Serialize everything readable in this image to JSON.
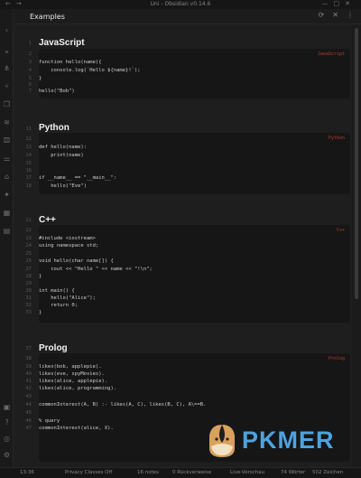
{
  "window": {
    "title": "Uni - Obsidian v0.14.6",
    "nav_back": "←",
    "nav_forward": "→",
    "controls": [
      "—",
      "□",
      "✕"
    ]
  },
  "ribbon": {
    "icons": [
      "chevron-right-icon",
      "map-pin-icon",
      "graph-icon",
      "git-branch-icon",
      "copy-icon",
      "layers-icon",
      "dice-icon",
      "sliders-icon",
      "bookmark-icon",
      "settings-icon",
      "calendar-icon",
      "grid-icon",
      "terminal-icon",
      "help-icon",
      "vault-icon",
      "gear-icon"
    ]
  },
  "tab": {
    "label": "Examples",
    "actions": [
      "⟳",
      "✕",
      "⋮"
    ]
  },
  "sections": [
    {
      "heading": "JavaScript",
      "heading_line": "1",
      "lang": "JavaScript",
      "lines": [
        {
          "no": "2",
          "text": ""
        },
        {
          "no": "3",
          "text": "function hello(name){"
        },
        {
          "no": "4",
          "text": "    console.log(`Hello ${name}!`);"
        },
        {
          "no": "5",
          "text": "}"
        },
        {
          "no": "6",
          "text": ""
        },
        {
          "no": "7",
          "text": "hello(\"Bob\")"
        }
      ]
    },
    {
      "heading": "Python",
      "heading_line": "11",
      "lang": "Python",
      "lines": [
        {
          "no": "12",
          "text": ""
        },
        {
          "no": "13",
          "text": "def hello(name):"
        },
        {
          "no": "14",
          "text": "    print(name)"
        },
        {
          "no": "15",
          "text": ""
        },
        {
          "no": "16",
          "text": ""
        },
        {
          "no": "17",
          "text": "if __name__ == \"__main__\":"
        },
        {
          "no": "18",
          "text": "    hello(\"Eve\")"
        }
      ]
    },
    {
      "heading": "C++",
      "heading_line": "21",
      "lang": "C++",
      "lines": [
        {
          "no": "22",
          "text": ""
        },
        {
          "no": "23",
          "text": "#include <iostream>"
        },
        {
          "no": "24",
          "text": "using namespace std;"
        },
        {
          "no": "25",
          "text": ""
        },
        {
          "no": "26",
          "text": "void hello(char name[]) {"
        },
        {
          "no": "27",
          "text": "    cout << \"Hello \" << name << \"!\\n\";"
        },
        {
          "no": "28",
          "text": "}"
        },
        {
          "no": "29",
          "text": ""
        },
        {
          "no": "30",
          "text": "int main() {"
        },
        {
          "no": "31",
          "text": "    hello(\"Alice\");"
        },
        {
          "no": "32",
          "text": "    return 0;"
        },
        {
          "no": "33",
          "text": "}"
        }
      ]
    },
    {
      "heading": "Prolog",
      "heading_line": "37",
      "lang": "Prolog",
      "lines": [
        {
          "no": "38",
          "text": ""
        },
        {
          "no": "39",
          "text": "likes(bob, applepie)."
        },
        {
          "no": "40",
          "text": "likes(eve, spyMovies)."
        },
        {
          "no": "41",
          "text": "likes(alice, applepie)."
        },
        {
          "no": "42",
          "text": "likes(alice, programming)."
        },
        {
          "no": "43",
          "text": ""
        },
        {
          "no": "44",
          "text": "commonInterest(A, B) :- likes(A, C), likes(B, C), A\\==B."
        },
        {
          "no": "45",
          "text": ""
        },
        {
          "no": "46",
          "text": "% query"
        },
        {
          "no": "47",
          "text": "commonInterest(alice, X)."
        }
      ]
    }
  ],
  "status": {
    "time": "13:36",
    "privacy": "Privacy Classes Off",
    "notes": "16 notes",
    "backlinks": "0 Rückverweise",
    "mode": "Live-Vorschau",
    "words": "74 Wörter",
    "chars": "502 Zeichen"
  },
  "logo": {
    "text": "PKMER",
    "color": "#4da3e0"
  },
  "colors": {
    "accent_red": "#c0392b",
    "background": "#1e1e1e",
    "code_bg": "#161616"
  }
}
